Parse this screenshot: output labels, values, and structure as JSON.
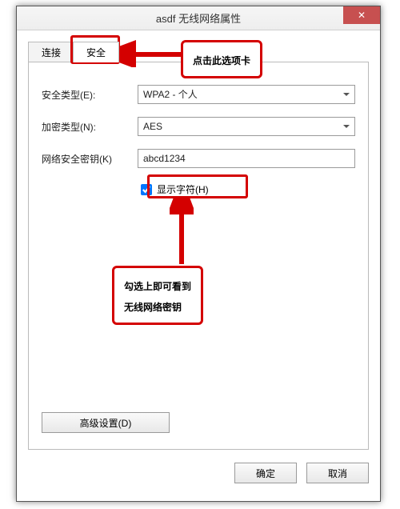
{
  "window": {
    "title": "asdf 无线网络属性"
  },
  "tabs": {
    "connect": "连接",
    "security": "安全"
  },
  "form": {
    "securityTypeLabel": "安全类型(E):",
    "securityTypeValue": "WPA2 - 个人",
    "encryptionLabel": "加密类型(N):",
    "encryptionValue": "AES",
    "keyLabel": "网络安全密钥(K)",
    "keyValue": "abcd1234",
    "showCharsLabel": "显示字符(H)",
    "advancedButton": "高级设置(D)"
  },
  "buttons": {
    "ok": "确定",
    "cancel": "取消"
  },
  "annotations": {
    "tabCallout": "点击此选项卡",
    "checkboxCalloutLine1": "勾选上即可看到",
    "checkboxCalloutLine2": "无线网络密钥"
  },
  "colors": {
    "annotation": "#d40000",
    "closeBtn": "#c75050"
  }
}
